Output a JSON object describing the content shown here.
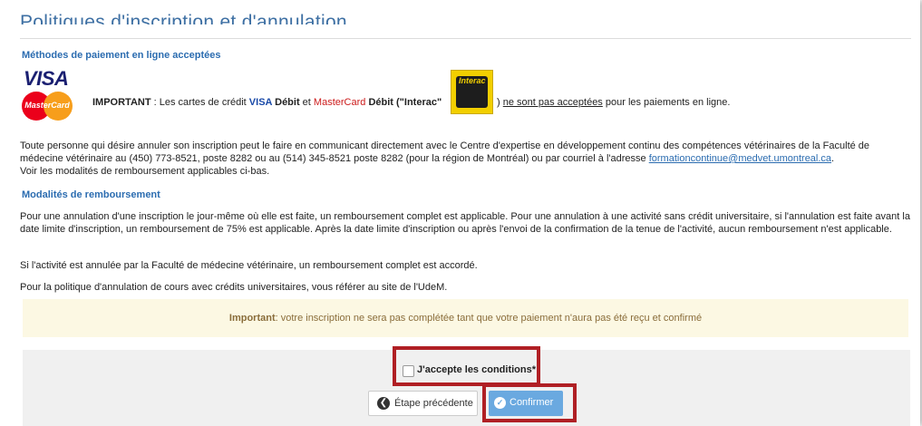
{
  "page": {
    "title": "Politiques d'inscription et d'annulation"
  },
  "payment": {
    "heading": "Méthodes de paiement en ligne acceptées",
    "logos": {
      "visa": "VISA",
      "mastercard": "MasterCard",
      "interac": "Interac"
    },
    "important_label": "IMPORTANT",
    "text_1": " : Les cartes de crédit ",
    "visa": "VISA",
    "debit_1": " Débit",
    "and": " et ",
    "mastercard": "MasterCard",
    "debit_2": " Débit",
    "paren_open": " (\"",
    "interac": "Interac",
    "paren_close": "\"",
    "close_paren": ") ",
    "not_accepted": "ne sont pas acceptées",
    "text_end": " pour les paiements en ligne."
  },
  "cancellation": {
    "paragraph": "Toute personne qui désire annuler son inscription peut le faire en communicant directement avec le Centre d'expertise en développement continu des compétences vétérinaires de la Faculté de médecine vétérinaire au (450) 773-8521, poste 8282 ou au (514) 345-8521 poste 8282 (pour la région de Montréal) ou par courriel à l'adresse ",
    "email": "formationcontinue@medvet.umontreal.ca",
    "paragraph_end": ".",
    "line_3": " Voir les modalités de remboursement applicables ci-bas."
  },
  "refund": {
    "heading": "Modalités de remboursement",
    "p1": "Pour une annulation d'une inscription le jour-même où elle est faite, un remboursement complet est applicable.  Pour une annulation à une activité sans crédit universitaire, si l'annulation est faite avant la date limite d'inscription, un remboursement de 75% est applicable. Après la date limite d'inscription ou après l'envoi de la confirmation de la tenue de l'activité, aucun remboursement n'est applicable.",
    "p2": "Si l'activité est annulée par la Faculté de médecine vétérinaire, un remboursement complet est accordé.",
    "p3": "Pour la politique d'annulation de cours avec crédits universitaires, vous référer au site de l'UdeM."
  },
  "notice": {
    "label": "Important",
    "text": ": votre inscription ne sera pas complétée tant que votre paiement n'aura pas été reçu et confirmé"
  },
  "form": {
    "accept_label": "J'accepte les conditions*",
    "accept_checked": false,
    "prev_button": "Étape précédente",
    "confirm_button": "Confirmer"
  },
  "colors": {
    "accent": "#2b6cb0",
    "highlight_frame": "#b01f24",
    "confirm_button": "#6aa9e0",
    "notice_bg": "#fcf8e3"
  },
  "icons": {
    "prev": "arrow-left-circle-icon",
    "confirm": "check-circle-icon"
  }
}
